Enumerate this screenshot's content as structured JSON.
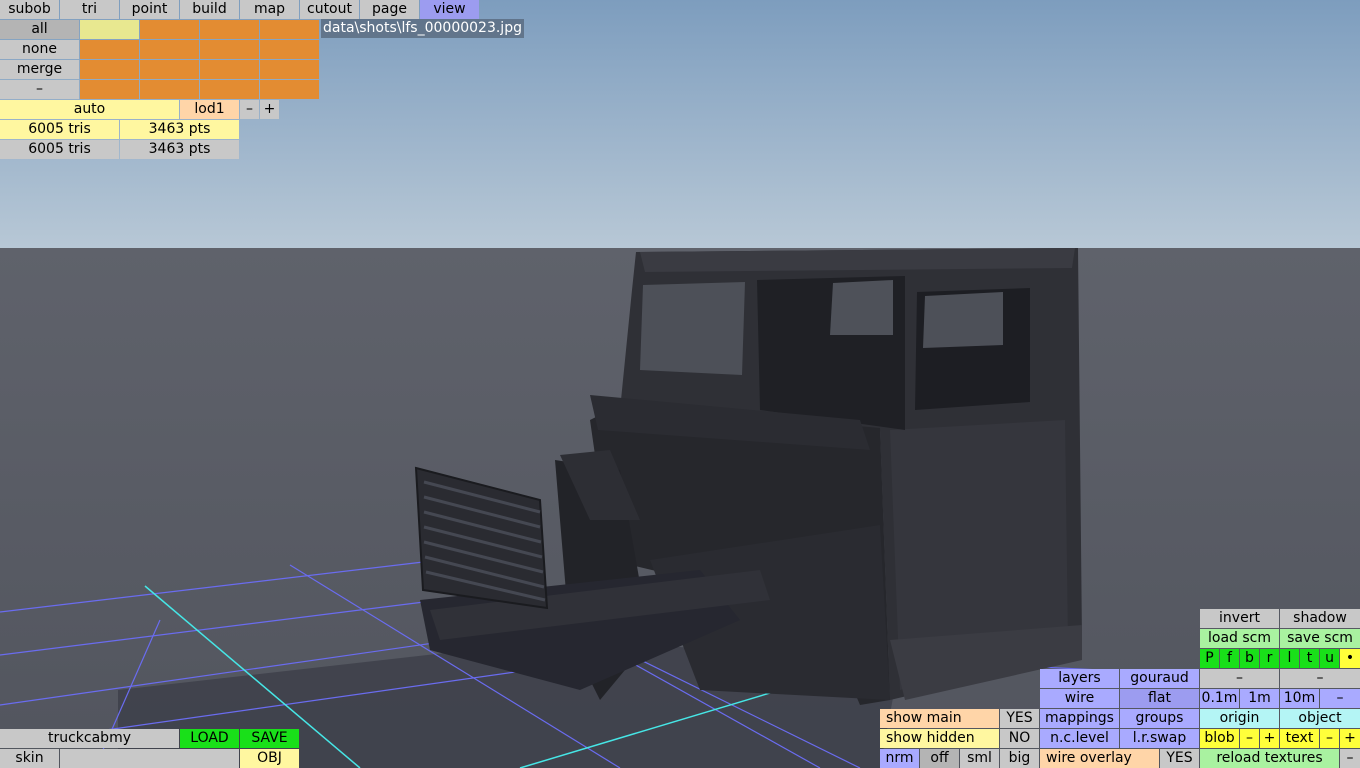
{
  "menu": [
    "subob",
    "tri",
    "point",
    "build",
    "map",
    "cutout",
    "page",
    "view"
  ],
  "left_panel": {
    "select_labels": [
      "all",
      "none",
      "merge",
      "–"
    ],
    "auto": "auto",
    "lod": "lod1",
    "minus": "–",
    "plus": "+",
    "stats": [
      {
        "tris": "6005 tris",
        "pts": "3463 pts"
      },
      {
        "tris": "6005 tris",
        "pts": "3463 pts"
      }
    ]
  },
  "file_path": "data\\shots\\lfs_00000023.jpg",
  "bottom_left": {
    "object_name": "truckcabmy",
    "load": "LOAD",
    "save": "SAVE",
    "skin": "skin",
    "obj": "OBJ"
  },
  "bottom_right": {
    "show_main": "show main",
    "show_main_val": "YES",
    "show_hidden": "show hidden",
    "show_hidden_val": "NO",
    "nrm": "nrm",
    "off": "off",
    "sml": "sml",
    "big": "big",
    "layers": "layers",
    "gouraud": "gouraud",
    "wire": "wire",
    "flat": "flat",
    "mappings": "mappings",
    "groups": "groups",
    "nclevel": "n.c.level",
    "lrswap": "l.r.swap",
    "wire_overlay": "wire overlay",
    "wire_overlay_val": "YES",
    "invert": "invert",
    "shadow": "shadow",
    "load_scm": "load scm",
    "save_scm": "save scm",
    "flags": [
      "P",
      "f",
      "b",
      "r",
      "l",
      "t",
      "u",
      "•"
    ],
    "dash1": "–",
    "dash2": "–",
    "dist": [
      "0.1m",
      "1m",
      "10m",
      "–"
    ],
    "origin": "origin",
    "object": "object",
    "blob": "blob",
    "text": "text",
    "minus": "–",
    "plus": "+",
    "reload": "reload textures"
  }
}
